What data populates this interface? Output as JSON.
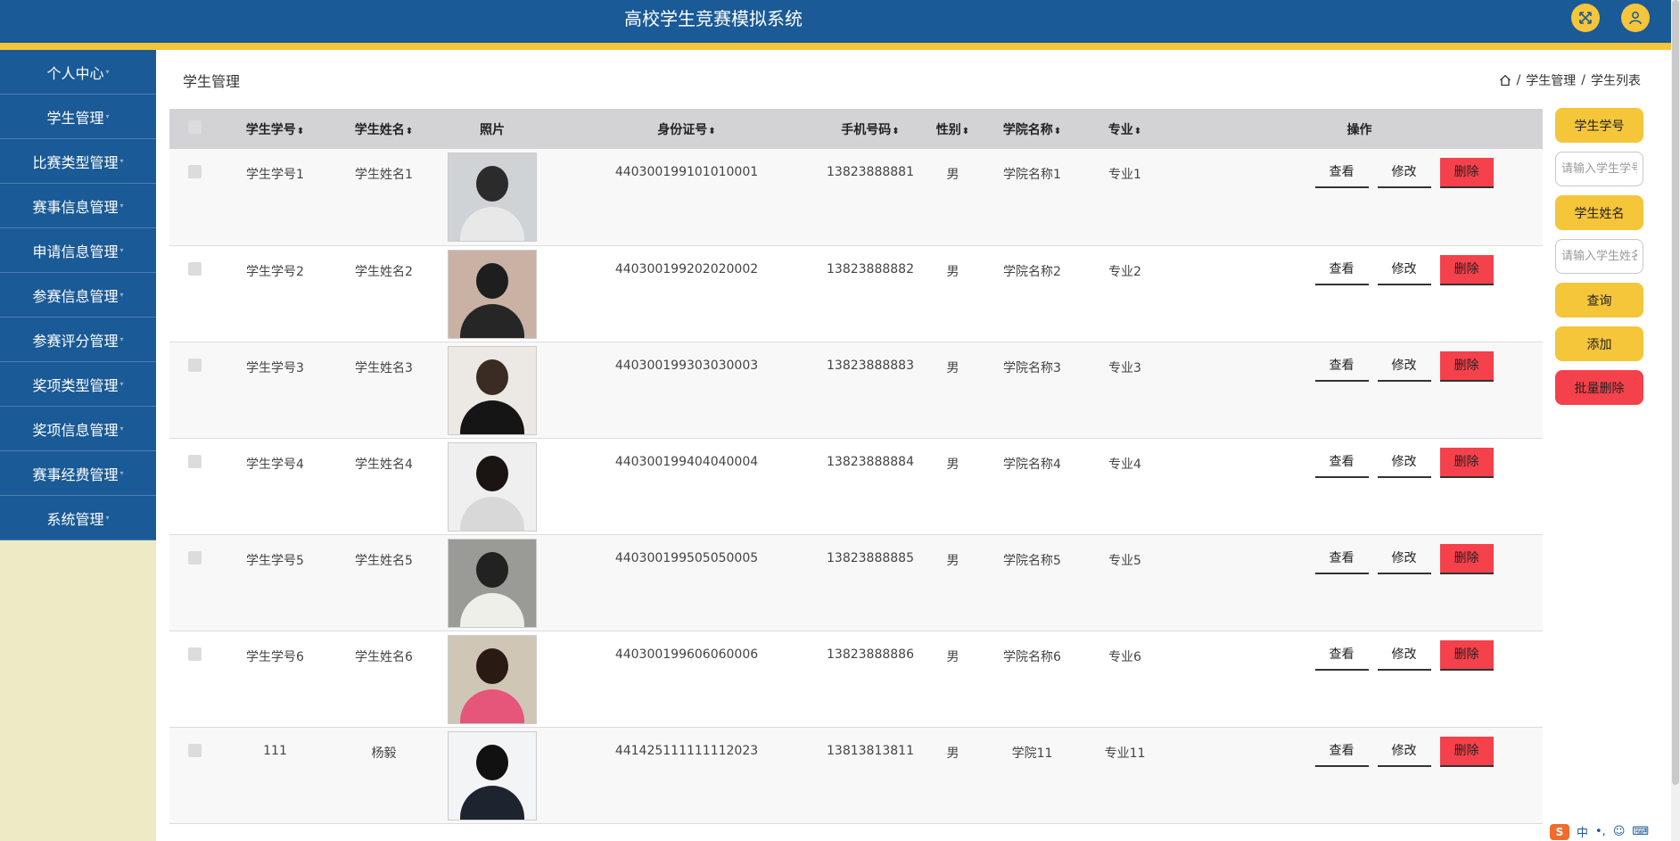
{
  "header": {
    "title": "高校学生竞赛模拟系统"
  },
  "sidebar": {
    "items": [
      {
        "label": "个人中心"
      },
      {
        "label": "学生管理"
      },
      {
        "label": "比赛类型管理"
      },
      {
        "label": "赛事信息管理"
      },
      {
        "label": "申请信息管理"
      },
      {
        "label": "参赛信息管理"
      },
      {
        "label": "参赛评分管理"
      },
      {
        "label": "奖项类型管理"
      },
      {
        "label": "奖项信息管理"
      },
      {
        "label": "赛事经费管理"
      },
      {
        "label": "系统管理"
      }
    ]
  },
  "page": {
    "title": "学生管理",
    "breadcrumb": [
      "学生管理",
      "学生列表"
    ]
  },
  "table": {
    "headers": {
      "student_no": "学生学号",
      "student_name": "学生姓名",
      "photo": "照片",
      "id_card": "身份证号",
      "phone": "手机号码",
      "gender": "性别",
      "college": "学院名称",
      "major": "专业",
      "ops": "操作"
    },
    "rows": [
      {
        "student_no": "学生学号1",
        "student_name": "学生姓名1",
        "id_card": "440300199101010001",
        "phone": "13823888881",
        "gender": "男",
        "college": "学院名称1",
        "major": "专业1"
      },
      {
        "student_no": "学生学号2",
        "student_name": "学生姓名2",
        "id_card": "440300199202020002",
        "phone": "13823888882",
        "gender": "男",
        "college": "学院名称2",
        "major": "专业2"
      },
      {
        "student_no": "学生学号3",
        "student_name": "学生姓名3",
        "id_card": "440300199303030003",
        "phone": "13823888883",
        "gender": "男",
        "college": "学院名称3",
        "major": "专业3"
      },
      {
        "student_no": "学生学号4",
        "student_name": "学生姓名4",
        "id_card": "440300199404040004",
        "phone": "13823888884",
        "gender": "男",
        "college": "学院名称4",
        "major": "专业4"
      },
      {
        "student_no": "学生学号5",
        "student_name": "学生姓名5",
        "id_card": "440300199505050005",
        "phone": "13823888885",
        "gender": "男",
        "college": "学院名称5",
        "major": "专业5"
      },
      {
        "student_no": "学生学号6",
        "student_name": "学生姓名6",
        "id_card": "440300199606060006",
        "phone": "13823888886",
        "gender": "男",
        "college": "学院名称6",
        "major": "专业6"
      },
      {
        "student_no": "111",
        "student_name": "杨毅",
        "id_card": "441425111111112023",
        "phone": "13813813811",
        "gender": "男",
        "college": "学院11",
        "major": "专业11"
      }
    ],
    "ops": {
      "view": "查看",
      "edit": "修改",
      "delete": "删除"
    }
  },
  "search": {
    "student_no_label": "学生学号",
    "student_no_placeholder": "请输入学生学号",
    "student_name_label": "学生姓名",
    "student_name_placeholder": "请输入学生姓名",
    "query": "查询",
    "add": "添加",
    "batch_delete": "批量删除"
  },
  "ime": {
    "mode": "中"
  },
  "colors": {
    "primary": "#1a5a96",
    "accent": "#f5c53a",
    "danger": "#f4414b",
    "sidebar_bg": "#ecebc5"
  }
}
